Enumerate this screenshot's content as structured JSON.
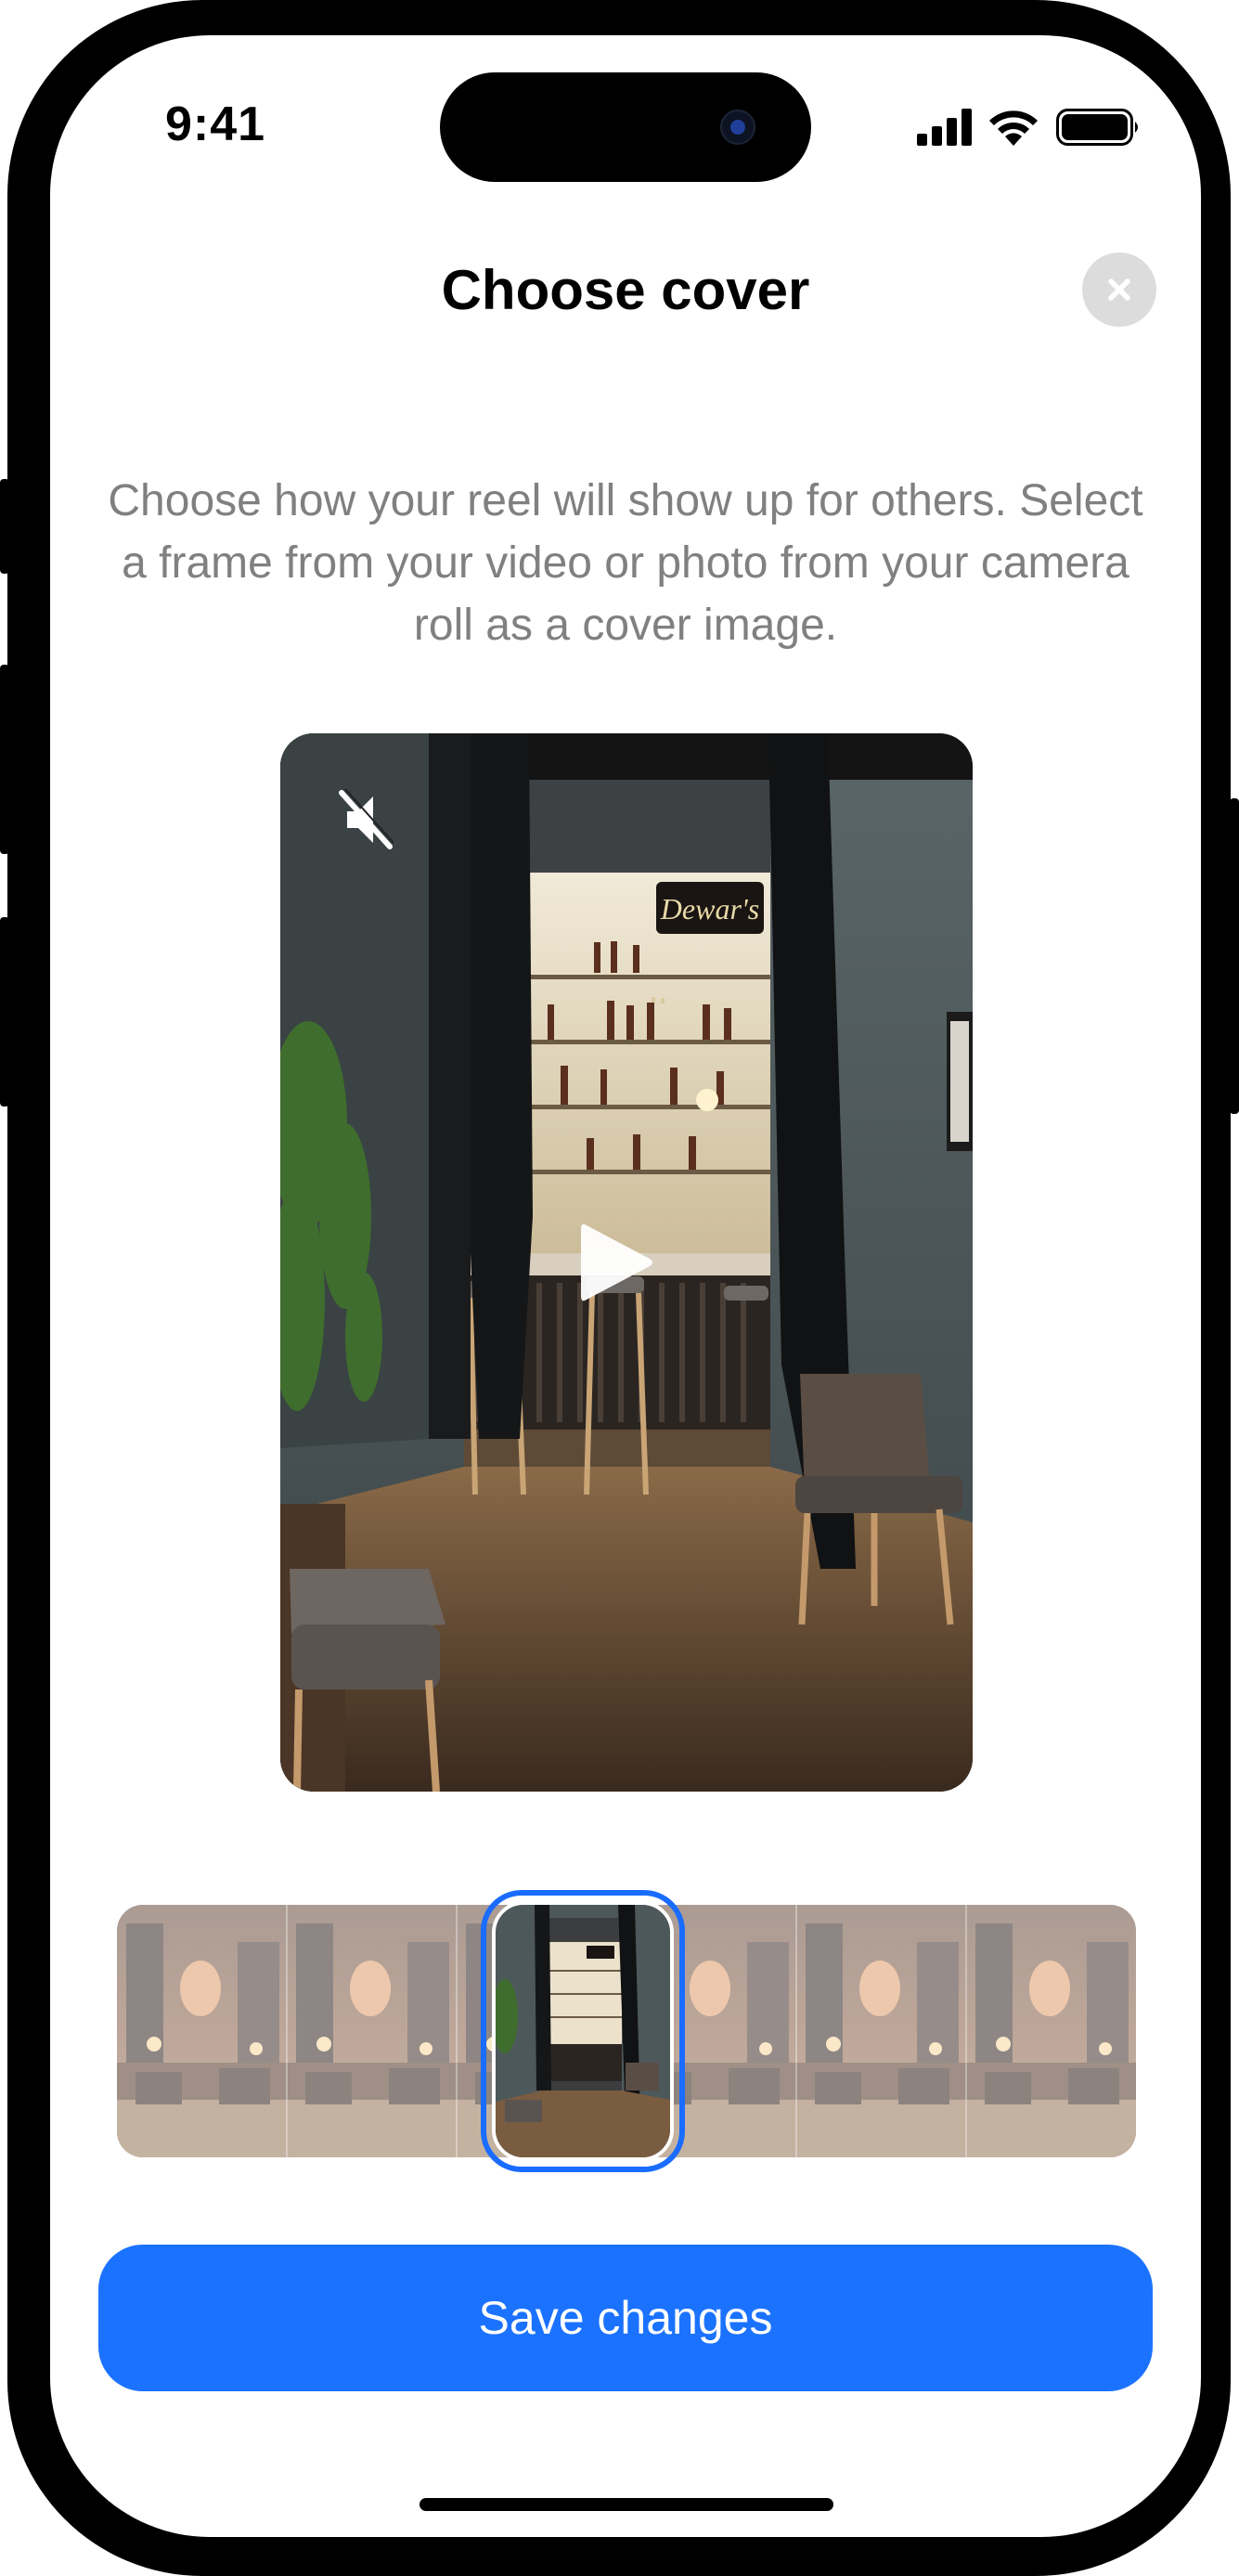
{
  "status_bar": {
    "time": "9:41",
    "icons": [
      "cellular-signal-icon",
      "wifi-icon",
      "battery-icon"
    ]
  },
  "header": {
    "title": "Choose cover",
    "close_icon": "close-icon"
  },
  "description": "Choose how your reel will show up for others. Select a frame from your video or photo from your camera roll as a cover image.",
  "preview": {
    "sign_text": "Dewar's",
    "mute_icon": "muted-speaker-icon",
    "play_icon": "play-icon"
  },
  "frame_strip": {
    "frame_count": 6,
    "selected_frame": 3,
    "accent_color": "#1a6cff"
  },
  "actions": {
    "save_label": "Save changes",
    "save_color": "#1b72ff"
  }
}
